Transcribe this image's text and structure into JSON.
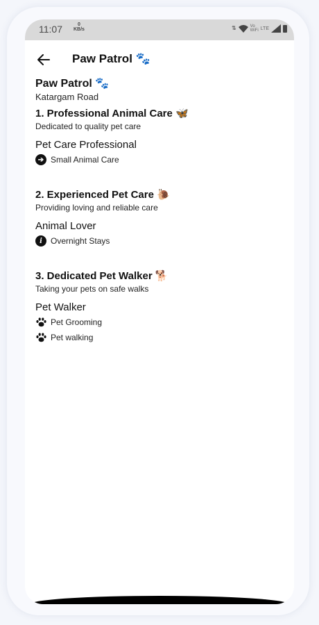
{
  "status_bar": {
    "time": "11:07",
    "net_speed_value": "0",
    "net_speed_unit": "KB/s",
    "volte_top": "Vo",
    "volte_bottom": "WiFi",
    "lte": "LTE"
  },
  "header": {
    "back_icon": "arrow-left-icon",
    "title": "Paw Patrol 🐾"
  },
  "provider": {
    "name": "Paw Patrol 🐾",
    "location": "Katargam Road"
  },
  "services": [
    {
      "title": "1. Professional Animal Care 🦋",
      "description": "Dedicated to quality pet care",
      "role": "Pet Care Professional",
      "skills": [
        {
          "icon": "arrow-right-circle-icon",
          "glyph": "➔",
          "label": "Small Animal Care"
        }
      ]
    },
    {
      "title": "2. Experienced Pet Care 🐌",
      "description": "Providing loving and reliable care",
      "role": "Animal Lover",
      "skills": [
        {
          "icon": "info-circle-icon",
          "glyph": "i",
          "label": "Overnight Stays"
        }
      ]
    },
    {
      "title": "3. Dedicated Pet Walker 🐕",
      "description": "Taking your pets on safe walks",
      "role": "Pet Walker",
      "skills": [
        {
          "icon": "paw-icon",
          "glyph": "🐾",
          "label": "Pet Grooming"
        },
        {
          "icon": "paw-icon",
          "glyph": "🐾",
          "label": "Pet walking"
        }
      ]
    }
  ]
}
